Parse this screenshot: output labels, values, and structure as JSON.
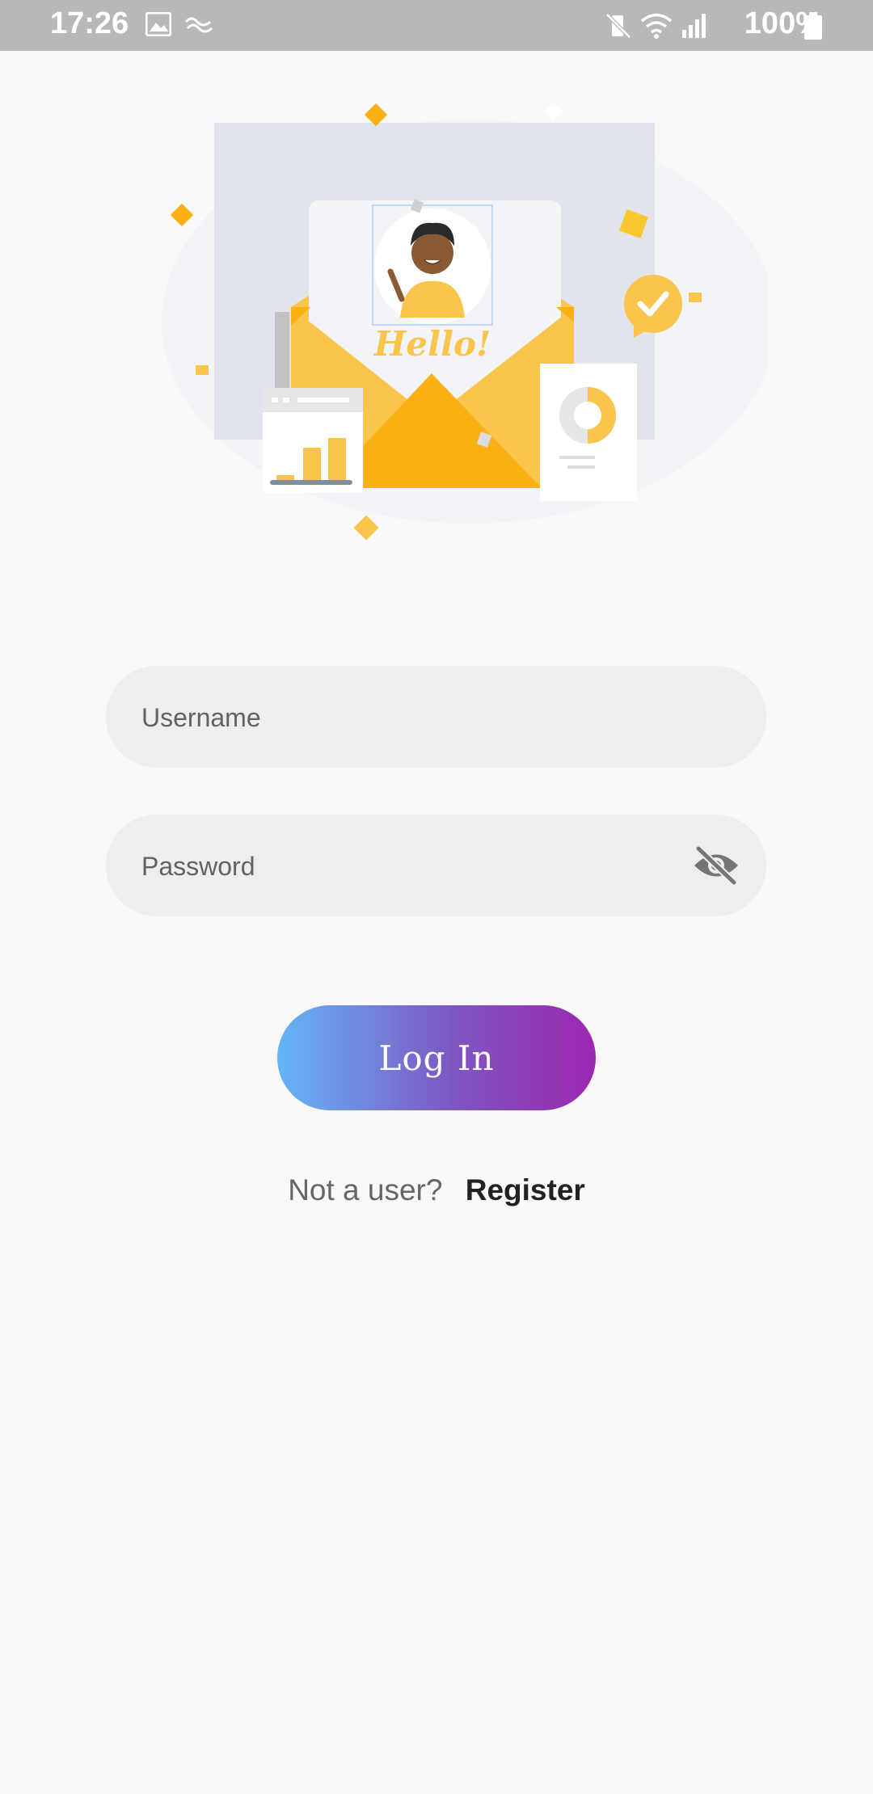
{
  "status_bar": {
    "time": "17:26",
    "battery": "100%",
    "left_icons": [
      "image-icon",
      "swap-wave-icon"
    ],
    "right_icons": [
      "vibrate-mute-icon",
      "wifi-icon",
      "signal-icon",
      "battery-icon"
    ]
  },
  "illustration": {
    "greeting": "Hello!",
    "icons": [
      "envelope-icon",
      "avatar-icon",
      "checkmark-badge-icon",
      "bar-chart-card-icon",
      "donut-chart-card-icon"
    ]
  },
  "form": {
    "username_placeholder": "Username",
    "password_placeholder": "Password",
    "username_value": "",
    "password_value": "",
    "toggle_icon": "visibility-off-icon"
  },
  "actions": {
    "login_label": "Log In",
    "register_prompt": "Not a user?",
    "register_label": "Register"
  },
  "colors": {
    "accent_yellow": "#fbb013",
    "gradient_start": "#64b5f6",
    "gradient_end": "#9c27b0",
    "field_bg": "#eeeeee",
    "status_bar": "#b8b8b8"
  }
}
